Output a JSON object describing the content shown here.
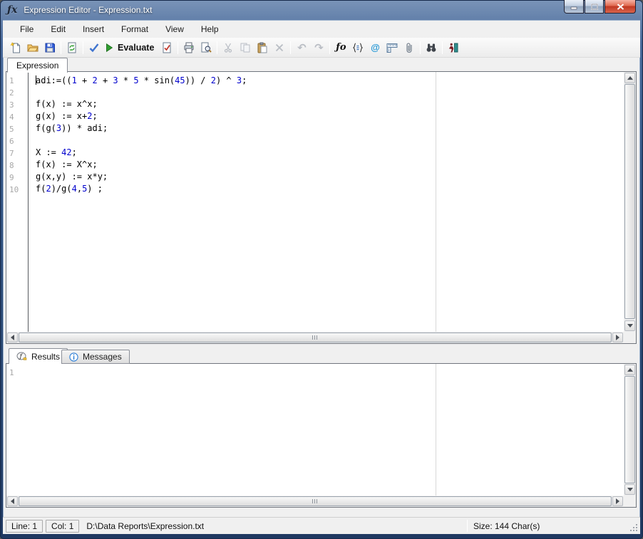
{
  "window": {
    "title": "Expression Editor - Expression.txt",
    "icon_glyph": "ƒx"
  },
  "menu": {
    "items": [
      "File",
      "Edit",
      "Insert",
      "Format",
      "View",
      "Help"
    ]
  },
  "toolbar": {
    "evaluate_label": "Evaluate",
    "icons": [
      "new-file",
      "open-file",
      "save-file",
      "refresh-document",
      "check-syntax",
      "evaluate-play",
      "validate-document",
      "print",
      "print-preview",
      "cut",
      "copy",
      "paste",
      "delete",
      "undo",
      "redo",
      "function",
      "variables-list",
      "at-reference",
      "ruler",
      "attachment",
      "find-binoculars",
      "goto-run"
    ],
    "fx_glyph": "ƒo",
    "at_glyph": "@",
    "undo_glyph": "↶",
    "redo_glyph": "↷"
  },
  "tabs": {
    "editor_tab": "Expression",
    "results_tab": "Results",
    "messages_tab": "Messages"
  },
  "editor": {
    "lines": [
      {
        "n": "1",
        "s": [
          [
            "adi:=((",
            "t"
          ],
          [
            "1",
            "n"
          ],
          [
            " + ",
            "t"
          ],
          [
            "2",
            "n"
          ],
          [
            " + ",
            "t"
          ],
          [
            "3",
            "n"
          ],
          [
            " * ",
            "t"
          ],
          [
            "5",
            "n"
          ],
          [
            " * sin(",
            "t"
          ],
          [
            "45",
            "n"
          ],
          [
            ")) / ",
            "t"
          ],
          [
            "2",
            "n"
          ],
          [
            ") ^ ",
            "t"
          ],
          [
            "3",
            "n"
          ],
          [
            ";",
            "t"
          ]
        ]
      },
      {
        "n": "2",
        "s": []
      },
      {
        "n": "3",
        "s": [
          [
            "f(x) := x^x;",
            "t"
          ]
        ]
      },
      {
        "n": "4",
        "s": [
          [
            "g(x) := x+",
            "t"
          ],
          [
            "2",
            "n"
          ],
          [
            ";",
            "t"
          ]
        ]
      },
      {
        "n": "5",
        "s": [
          [
            "f(g(",
            "t"
          ],
          [
            "3",
            "n"
          ],
          [
            ")) * adi;",
            "t"
          ]
        ]
      },
      {
        "n": "6",
        "s": []
      },
      {
        "n": "7",
        "s": [
          [
            "X := ",
            "t"
          ],
          [
            "42",
            "n"
          ],
          [
            ";",
            "t"
          ]
        ]
      },
      {
        "n": "8",
        "s": [
          [
            "f(x) := X^x;",
            "t"
          ]
        ]
      },
      {
        "n": "9",
        "s": [
          [
            "g(x,y) := x*y;",
            "t"
          ]
        ]
      },
      {
        "n": "10",
        "s": [
          [
            "f(",
            "t"
          ],
          [
            "2",
            "n"
          ],
          [
            ")/g(",
            "t"
          ],
          [
            "4",
            "n"
          ],
          [
            ",",
            "t"
          ],
          [
            "5",
            "n"
          ],
          [
            ") ;",
            "t"
          ]
        ]
      }
    ],
    "caret": {
      "line": 1,
      "col": 1
    }
  },
  "results": {
    "line_numbers": [
      "1"
    ],
    "content": ""
  },
  "status_bar": {
    "line": "Line: 1",
    "col": "Col: 1",
    "path": "D:\\Data Reports\\Expression.txt",
    "size": "Size: 144 Char(s)"
  },
  "colors": {
    "titlebar_blue": "#31527f",
    "close_red": "#c03722",
    "number_literal": "#0000cd",
    "line_number_gray": "#a8a8a8",
    "margin_guide": "#d8d8d8",
    "evaluate_green": "#2f9e2f",
    "check_blue": "#3f74cf"
  }
}
